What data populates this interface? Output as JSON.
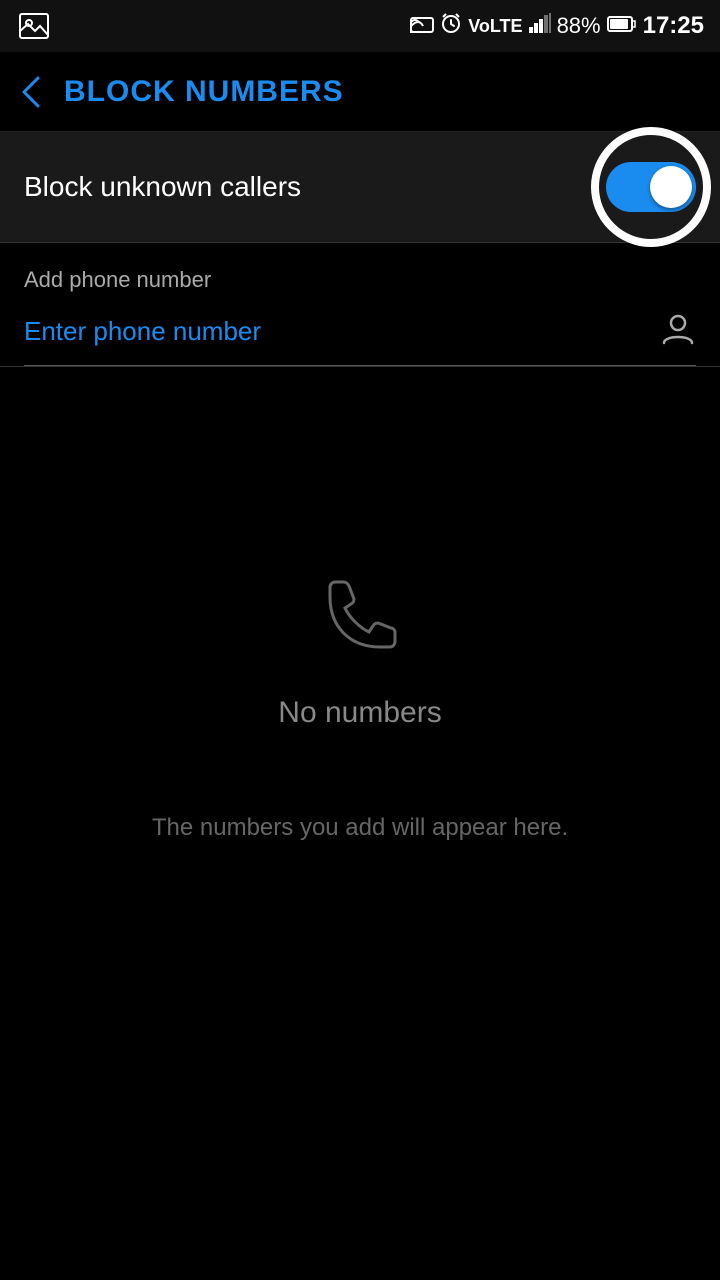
{
  "statusBar": {
    "time": "17:25",
    "batteryPercent": "88%",
    "icons": [
      "cast",
      "alarm",
      "volte",
      "signal",
      "battery"
    ]
  },
  "navigation": {
    "backLabel": "<",
    "title": "BLOCK NUMBERS"
  },
  "blockUnknown": {
    "label": "Block unknown callers",
    "toggleEnabled": true
  },
  "addPhone": {
    "sectionLabel": "Add phone number",
    "inputPlaceholder": "Enter phone number",
    "contactIconLabel": "contact"
  },
  "emptyState": {
    "noNumbersText": "No numbers",
    "description": "The numbers you add will appear here."
  }
}
